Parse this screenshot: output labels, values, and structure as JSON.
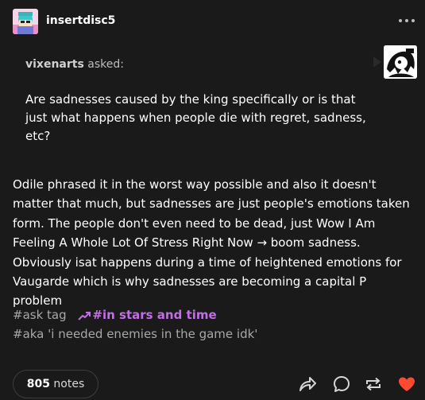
{
  "post": {
    "blog_name": "insertdisc5",
    "ask": {
      "asker": "vixenarts",
      "asked_label": "asked:",
      "question": "Are sadnesses caused by the king specifically or is that just what happens when people die with regret, sadness, etc?"
    },
    "body": "Odile phrased it in the worst way possible and also it doesn't matter that much, but sadnesses are just people's emotions taken form. The people don't even need to be dead, just Wow I Am Feeling A Whole Lot Of Stress Right Now → boom sadness. Obviously isat happens during a time of heightened emotions for Vaugarde which is why sadnesses are becoming a capital P problem",
    "tags": [
      "#ask tag",
      "#in stars and time",
      "#aka 'i needed enemies in the game idk'"
    ],
    "notes": {
      "count": "805",
      "label": "notes"
    }
  },
  "colors": {
    "background": "#1a1a1a",
    "text": "#ffffff",
    "muted": "#a8a8a8",
    "featured_tag": "#c36ee8",
    "like": "#ff4930"
  },
  "icons": {
    "menu": "more-horizontal-icon",
    "featured_tag": "trending-icon",
    "share": "share-icon",
    "reply": "reply-icon",
    "reblog": "reblog-icon",
    "like": "heart-icon"
  }
}
